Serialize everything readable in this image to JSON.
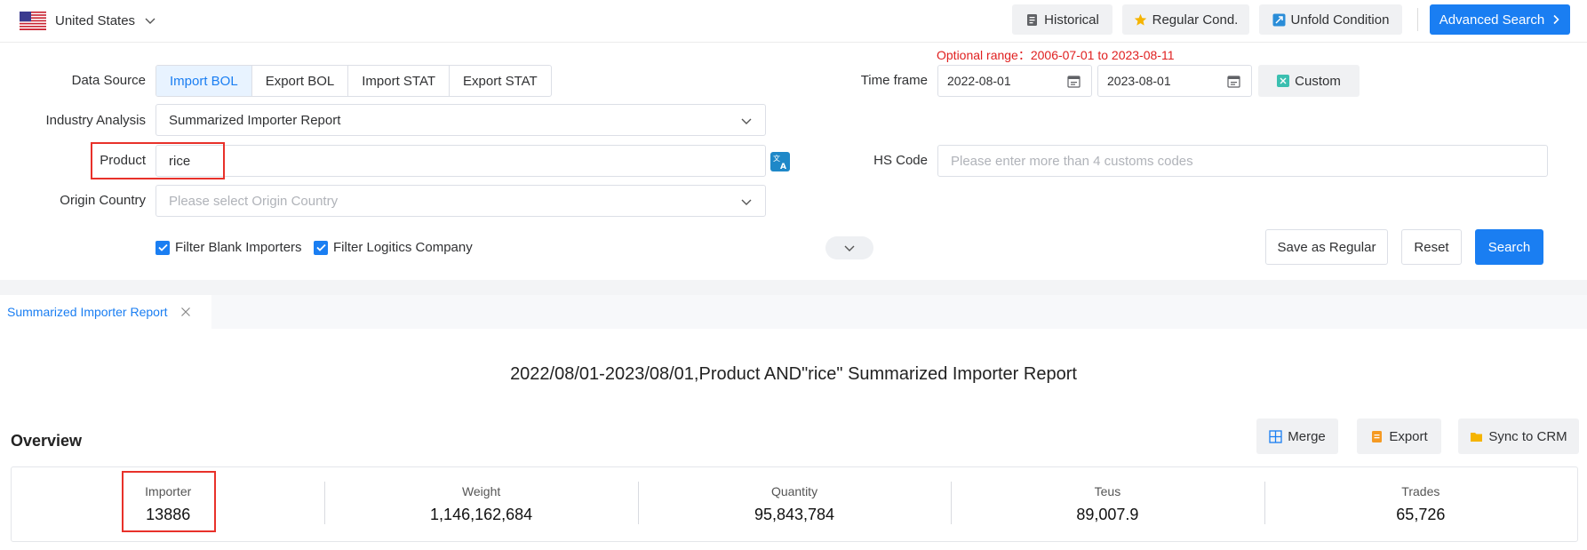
{
  "header": {
    "country": "United States",
    "buttons": {
      "historical": "Historical",
      "regular_cond": "Regular Cond.",
      "unfold_condition": "Unfold Condition",
      "advanced_search": "Advanced Search"
    },
    "accent_color": "#1a7ef2"
  },
  "form": {
    "optional_range": "Optional range：2006-07-01 to 2023-08-11",
    "data_source_label": "Data Source",
    "data_source_options": [
      "Import BOL",
      "Export BOL",
      "Import STAT",
      "Export STAT"
    ],
    "data_source_selected": "Import BOL",
    "industry_label": "Industry Analysis",
    "industry_value": "Summarized Importer Report",
    "product_label": "Product",
    "product_value": "rice",
    "origin_label": "Origin Country",
    "origin_placeholder": "Please select Origin Country",
    "time_frame_label": "Time frame",
    "date_from": "2022-08-01",
    "date_to": "2023-08-01",
    "custom_label": "Custom",
    "hs_code_label": "HS Code",
    "hs_code_placeholder": "Please enter more than 4 customs codes",
    "filter_blank": "Filter Blank Importers",
    "filter_logistics": "Filter Logitics Company",
    "save_regular": "Save as Regular",
    "reset": "Reset",
    "search": "Search"
  },
  "tabs": [
    {
      "label": "Summarized Importer Report",
      "active": true
    }
  ],
  "report": {
    "title": "2022/08/01-2023/08/01,Product AND\"rice\" Summarized Importer Report",
    "overview_label": "Overview",
    "actions": {
      "merge": "Merge",
      "export": "Export",
      "sync_crm": "Sync to CRM"
    },
    "stats": [
      {
        "label": "Importer",
        "value": "13886"
      },
      {
        "label": "Weight",
        "value": "1,146,162,684"
      },
      {
        "label": "Quantity",
        "value": "95,843,784"
      },
      {
        "label": "Teus",
        "value": "89,007.9"
      },
      {
        "label": "Trades",
        "value": "65,726"
      }
    ]
  }
}
